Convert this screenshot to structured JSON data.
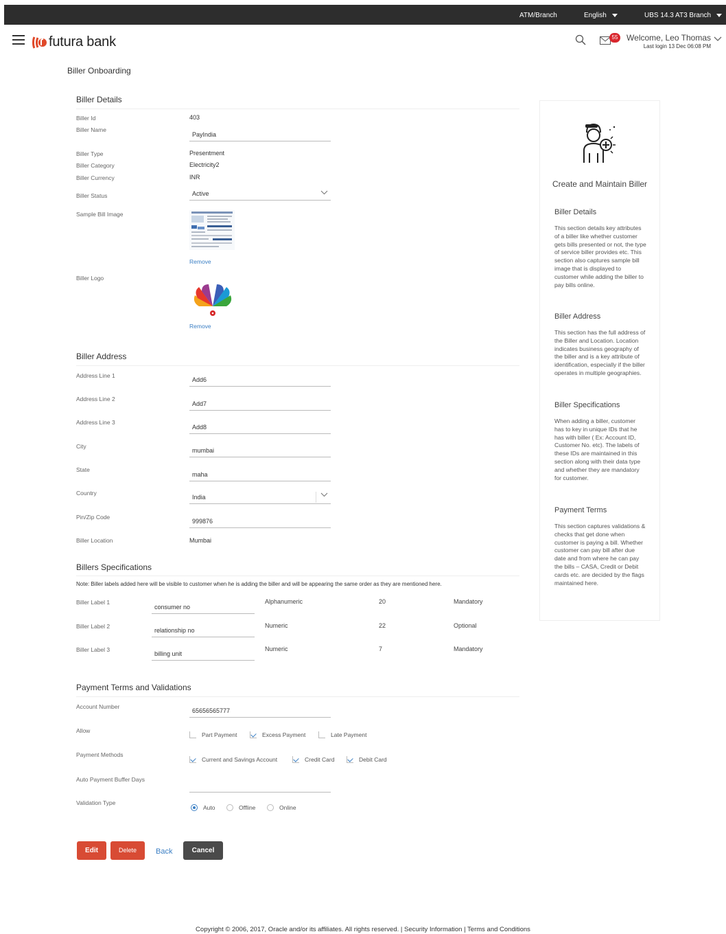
{
  "topbar": {
    "atm_branch": "ATM/Branch",
    "language": "English",
    "branch": "UBS 14.3 AT3 Branch"
  },
  "header": {
    "brand": "futura bank",
    "notification_count": "55",
    "welcome": "Welcome, Leo Thomas",
    "last_login": "Last login 13 Dec 06:08 PM"
  },
  "page": {
    "title": "Biller Onboarding"
  },
  "biller_details": {
    "section_title": "Biller Details",
    "biller_id_label": "Biller Id",
    "biller_id": "403",
    "biller_name_label": "Biller Name",
    "biller_name": "PayIndia",
    "biller_type_label": "Biller Type",
    "biller_type": "Presentment",
    "biller_category_label": "Biller Category",
    "biller_category": "Electricity2",
    "biller_currency_label": "Biller Currency",
    "biller_currency": "INR",
    "biller_status_label": "Biller Status",
    "biller_status": "Active",
    "sample_bill_label": "Sample Bill Image",
    "remove_label": "Remove",
    "biller_logo_label": "Biller Logo"
  },
  "biller_address": {
    "section_title": "Biller Address",
    "line1_label": "Address Line 1",
    "line1": "Add6",
    "line2_label": "Address Line 2",
    "line2": "Add7",
    "line3_label": "Address Line 3",
    "line3": "Add8",
    "city_label": "City",
    "city": "mumbai",
    "state_label": "State",
    "state": "maha",
    "country_label": "Country",
    "country": "India",
    "pin_label": "Pin/Zip Code",
    "pin": "999876",
    "location_label": "Biller Location",
    "location": "Mumbai"
  },
  "specifications": {
    "section_title": "Billers Specifications",
    "note": "Note: Biller labels added here will be visible to customer when he is adding the biller and will be appearing the same order as they are mentioned here.",
    "rows": [
      {
        "label": "Biller Label 1",
        "value": "consumer no",
        "type": "Alphanumeric",
        "length": "20",
        "requirement": "Mandatory"
      },
      {
        "label": "Biller Label 2",
        "value": "relationship no",
        "type": "Numeric",
        "length": "22",
        "requirement": "Optional"
      },
      {
        "label": "Biller Label 3",
        "value": "billing unit",
        "type": "Numeric",
        "length": "7",
        "requirement": "Mandatory"
      }
    ]
  },
  "payment_terms": {
    "section_title": "Payment Terms and Validations",
    "account_number_label": "Account Number",
    "account_number": "65656565777",
    "allow_label": "Allow",
    "allow_options": [
      "Part Payment",
      "Excess Payment",
      "Late Payment"
    ],
    "methods_label": "Payment Methods",
    "method_options": [
      "Current and Savings Account",
      "Credit Card",
      "Debit Card"
    ],
    "buffer_days_label": "Auto Payment Buffer Days",
    "buffer_days": "",
    "validation_label": "Validation Type",
    "validation_options": [
      "Auto",
      "Offline",
      "Online"
    ]
  },
  "actions": {
    "edit": "Edit",
    "delete": "Delete",
    "back": "Back",
    "cancel": "Cancel"
  },
  "help": {
    "title": "Create and Maintain Biller",
    "sections": [
      {
        "title": "Biller Details",
        "text": "This section details key attributes of a biller like whether customer gets bills presented or not, the type of service biller provides etc. This section also captures sample bill image that is displayed to customer while adding the biller to pay bills online."
      },
      {
        "title": "Biller Address",
        "text": "This section has the full address of the Biller and Location. Location indicates business geography of the biller and is a key attribute of identification, especially if the biller operates in multiple geographies."
      },
      {
        "title": "Biller Specifications",
        "text": "When adding a biller, customer has to key in unique IDs that he has with biller ( Ex: Account ID, Customer No. etc). The labels of these IDs are maintained in this section along with their data type and whether they are mandatory for customer."
      },
      {
        "title": "Payment Terms",
        "text": "This section captures validations & checks that get done when customer is paying a bill. Whether customer can pay bill after due date and from where he can pay the bills – CASA, Credit or Debit cards etc. are decided by the flags maintained here."
      }
    ]
  },
  "footer": {
    "text": "Copyright © 2006, 2017, Oracle and/or its affiliates. All rights reserved. | Security Information | Terms and Conditions"
  }
}
